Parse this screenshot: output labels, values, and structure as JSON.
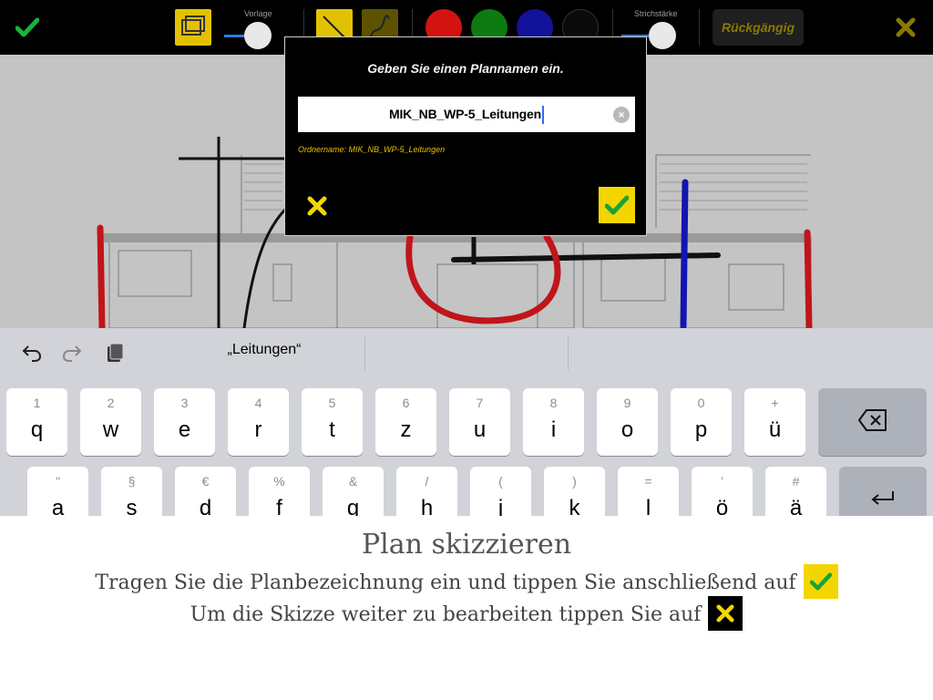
{
  "toolbar": {
    "check_icon": "check-icon",
    "template_label": "Vorlage",
    "stroke_label": "Strichstärke",
    "undo_label": "Rückgängig",
    "close_icon": "close-icon",
    "colors": {
      "red": "#d31212",
      "green": "#0d7a12",
      "blue": "#12129a",
      "black": "#0a0a0a"
    },
    "accent": "#e2c200"
  },
  "dialog": {
    "title": "Geben Sie einen Plannamen ein.",
    "input_value": "MIK_NB_WP-5_Leitungen",
    "folder_text": "Ordnername: MIK_NB_WP-5_Leitungen",
    "ok_icon": "check-icon",
    "cancel_icon": "close-icon"
  },
  "keyboard": {
    "suggestion": "„Leitungen“",
    "row1": [
      {
        "num": "1",
        "ch": "q"
      },
      {
        "num": "2",
        "ch": "w"
      },
      {
        "num": "3",
        "ch": "e"
      },
      {
        "num": "4",
        "ch": "r"
      },
      {
        "num": "5",
        "ch": "t"
      },
      {
        "num": "6",
        "ch": "z"
      },
      {
        "num": "7",
        "ch": "u"
      },
      {
        "num": "8",
        "ch": "i"
      },
      {
        "num": "9",
        "ch": "o"
      },
      {
        "num": "0",
        "ch": "p"
      },
      {
        "num": "+",
        "ch": "ü"
      }
    ],
    "row2": [
      {
        "num": "\"",
        "ch": "a"
      },
      {
        "num": "§",
        "ch": "s"
      },
      {
        "num": "€",
        "ch": "d"
      },
      {
        "num": "%",
        "ch": "f"
      },
      {
        "num": "&",
        "ch": "g"
      },
      {
        "num": "/",
        "ch": "h"
      },
      {
        "num": "(",
        "ch": "j"
      },
      {
        "num": ")",
        "ch": "k"
      },
      {
        "num": "=",
        "ch": "l"
      },
      {
        "num": "’",
        "ch": "ö"
      },
      {
        "num": "#",
        "ch": "ä"
      }
    ]
  },
  "caption": {
    "title": "Plan skizzieren",
    "line1": "Tragen Sie die Planbezeichnung ein und tippen Sie anschließend auf",
    "line2": "Um die Skizze weiter zu bearbeiten tippen Sie auf"
  }
}
